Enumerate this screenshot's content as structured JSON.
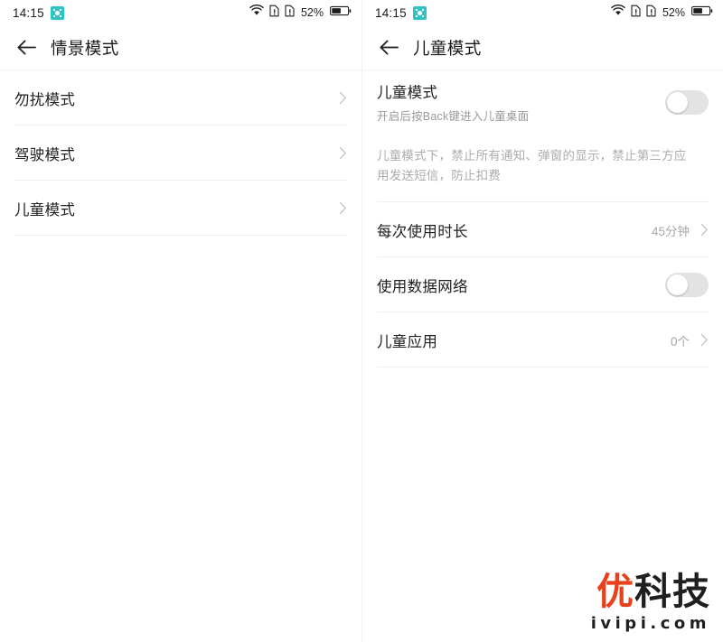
{
  "statusbar": {
    "time": "14:15",
    "battery_percent": "52%",
    "icons": [
      "app-badge-icon",
      "wifi-icon",
      "sim1-no-card-icon",
      "sim2-no-card-icon",
      "battery-icon"
    ],
    "accent_badge_color": "#2ec4c4"
  },
  "left_screen": {
    "title": "情景模式",
    "back_icon": "back-arrow-icon",
    "items": [
      {
        "label": "勿扰模式",
        "chevron": "chevron-right-icon"
      },
      {
        "label": "驾驶模式",
        "chevron": "chevron-right-icon"
      },
      {
        "label": "儿童模式",
        "chevron": "chevron-right-icon"
      }
    ]
  },
  "right_screen": {
    "title": "儿童模式",
    "back_icon": "back-arrow-icon",
    "master_toggle": {
      "label": "儿童模式",
      "subtitle": "开启后按Back键进入儿童桌面",
      "state": "off"
    },
    "description": "儿童模式下，禁止所有通知、弹窗的显示，禁止第三方应用发送短信，防止扣费",
    "items": [
      {
        "label": "每次使用时长",
        "value": "45分钟",
        "type": "link",
        "chevron": "chevron-right-icon"
      },
      {
        "label": "使用数据网络",
        "value": "",
        "type": "toggle",
        "state": "off"
      },
      {
        "label": "儿童应用",
        "value": "0个",
        "type": "link",
        "chevron": "chevron-right-icon"
      }
    ]
  },
  "watermark": {
    "brand_first": "优",
    "brand_rest": "科技",
    "domain": "ivipi.com",
    "accent_color": "#e8401c"
  }
}
